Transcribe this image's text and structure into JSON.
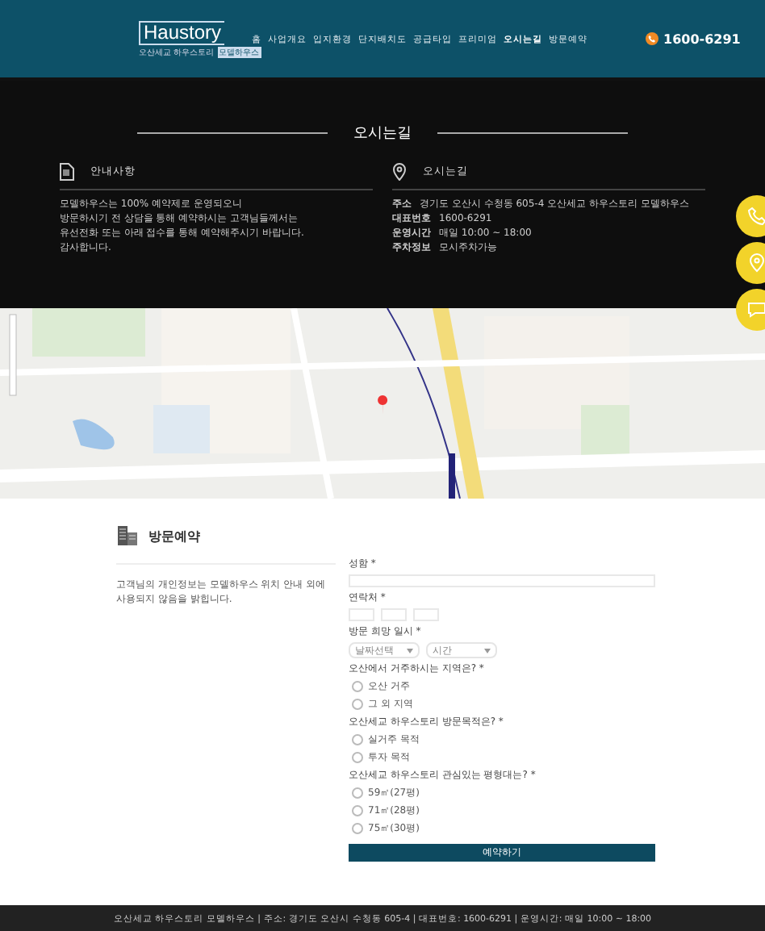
{
  "header": {
    "logo": "Haustory",
    "logo_sub": "오산세교 하우스토리",
    "logo_badge": "모델하우스",
    "nav": [
      {
        "label": "홈",
        "selected": false
      },
      {
        "label": "사업개요",
        "selected": false
      },
      {
        "label": "입지환경",
        "selected": false
      },
      {
        "label": "단지배치도",
        "selected": false
      },
      {
        "label": "공급타입",
        "selected": false
      },
      {
        "label": "프리미엄",
        "selected": false
      },
      {
        "label": "오시는길",
        "selected": true
      },
      {
        "label": "방문예약",
        "selected": false
      }
    ],
    "phone": "1600-6291"
  },
  "location": {
    "title": "오시는길",
    "notice": {
      "title": "안내사항",
      "lines": [
        "모델하우스는 100% 예약제로 운영되오니",
        "방문하시기 전 상담을 통해 예약하시는 고객님들께서는",
        "유선전화 또는 아래 접수를 통해 예약해주시기 바랍니다.",
        "감사합니다."
      ]
    },
    "directions": {
      "title": "오시는길",
      "rows": [
        {
          "label": "주소",
          "value": "경기도 오산시 수청동 605-4 오산세교 하우스토리 모델하우스"
        },
        {
          "label": "대표번호",
          "value": "1600-6291"
        },
        {
          "label": "운영시간",
          "value": "매일 10:00 ~ 18:00"
        },
        {
          "label": "주차정보",
          "value": "모시주차가능"
        }
      ]
    }
  },
  "reservation": {
    "title": "방문예약",
    "notice": "고객님의 개인정보는 모델하우스 위치 안내 외에 사용되지 않음을 밝힙니다.",
    "name_label": "성함 *",
    "phone_label": "연락처 *",
    "date_label": "방문 희망 일시 *",
    "date_placeholder": "날짜선택",
    "time_placeholder": "시간",
    "questions": [
      {
        "label": "오산에서 거주하시는 지역은? *",
        "options": [
          {
            "label": "오산 거주",
            "selected": false
          },
          {
            "label": "그 외 지역",
            "selected": false
          }
        ]
      },
      {
        "label": "오산세교 하우스토리 방문목적은? *",
        "options": [
          {
            "label": "실거주 목적",
            "selected": false
          },
          {
            "label": "투자 목적",
            "selected": false
          }
        ]
      },
      {
        "label": "오산세교 하우스토리 관심있는 평형대는? *",
        "options": [
          {
            "label": "59㎡(27평)",
            "selected": false
          },
          {
            "label": "71㎡(28평)",
            "selected": false
          },
          {
            "label": "75㎡(30평)",
            "selected": false
          }
        ]
      }
    ],
    "submit": "예약하기"
  },
  "footer": {
    "lines": [
      "오산세교 하우스토리 모델하우스 | 주소: 경기도 오산시 수청동 605-4 | 대표번호: 1600-6291 | 운영시간: 매일 10:00 ~ 18:00"
    ]
  },
  "quick": [
    {
      "kind": "phone"
    },
    {
      "kind": "pin"
    },
    {
      "kind": "chat"
    }
  ]
}
